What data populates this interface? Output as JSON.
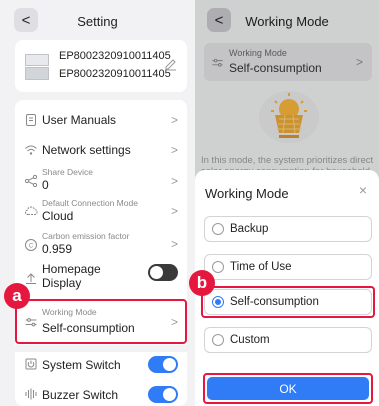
{
  "left_panel": {
    "back_label": "<",
    "title": "Setting",
    "device": {
      "serial_1": "EP8002320910011405",
      "serial_2": "EP8002320910011405"
    },
    "rows": {
      "user_manuals": {
        "label": "User Manuals",
        "icon": "book-icon"
      },
      "network_settings": {
        "label": "Network settings",
        "icon": "wifi-icon"
      },
      "share_device": {
        "sublabel": "Share Device",
        "value": "0",
        "icon": "share-icon"
      },
      "default_connection_mode": {
        "sublabel": "Default Connection Mode",
        "value": "Cloud",
        "icon": "cloud-icon"
      },
      "carbon_emission_factor": {
        "sublabel": "Carbon emission factor",
        "value": "0.959",
        "icon": "carbon-icon"
      },
      "homepage_display": {
        "label_line1": "Homepage",
        "label_line2": "Display",
        "toggle": "off",
        "icon": "upload-icon"
      },
      "working_mode": {
        "sublabel": "Working Mode",
        "value": "Self-consumption",
        "icon": "sliders-icon"
      },
      "system_switch": {
        "label": "System Switch",
        "toggle": "on",
        "icon": "power-icon"
      },
      "buzzer_switch": {
        "label": "Buzzer Switch",
        "toggle": "on",
        "icon": "buzzer-icon"
      }
    },
    "chevron": ">",
    "badge": "a"
  },
  "right_panel": {
    "back_label": "<",
    "title": "Working Mode",
    "current_mode": {
      "sublabel": "Working Mode",
      "value": "Self-consumption"
    },
    "description": "In this mode, the system prioritizes direct solar energy consumption for household needs.",
    "sheet": {
      "title": "Working Mode",
      "close": "×",
      "options": [
        {
          "label": "Backup",
          "selected": false
        },
        {
          "label": "Time of Use",
          "selected": false
        },
        {
          "label": "Self-consumption",
          "selected": true
        },
        {
          "label": "Custom",
          "selected": false
        }
      ],
      "ok_label": "OK"
    },
    "badge": "b"
  },
  "colors": {
    "accent_blue": "#2f7cf6",
    "highlight_red": "#e5173f",
    "toggle_off": "#3a3a3a"
  }
}
